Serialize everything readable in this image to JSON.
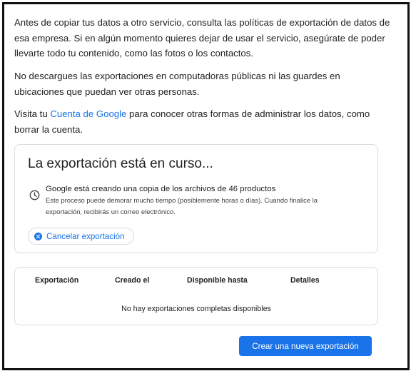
{
  "intro": {
    "para1": "Antes de copiar tus datos a otro servicio, consulta las políticas de exportación de datos de esa empresa. Si en algún momento quieres dejar de usar el servicio, asegúrate de poder llevarte todo tu contenido, como las fotos o los contactos.",
    "para2": "No descargues las exportaciones en computadoras públicas ni las guardes en ubicaciones que puedan ver otras personas.",
    "para3_before": "Visita tu ",
    "para3_link": "Cuenta de Google",
    "para3_after": " para conocer otras formas de administrar los datos, como borrar la cuenta."
  },
  "export_card": {
    "title": "La exportación está en curso...",
    "status_main": "Google está creando una copia de los archivos de 46 productos",
    "status_detail": "Este proceso puede demorar mucho tiempo (posiblemente horas o días). Cuando finalice la exportación, recibirás un correo electrónico.",
    "cancel_label": "Cancelar exportación",
    "status_icon": "clock-icon",
    "cancel_icon": "cancel-circle-icon"
  },
  "exports_table": {
    "headers": [
      "Exportación",
      "Creado el",
      "Disponible hasta",
      "Detalles"
    ],
    "empty_message": "No hay exportaciones completas disponibles"
  },
  "actions": {
    "create_label": "Crear una nueva exportación"
  },
  "colors": {
    "accent": "#1a73e8",
    "border": "#dadce0",
    "text": "#202124"
  }
}
